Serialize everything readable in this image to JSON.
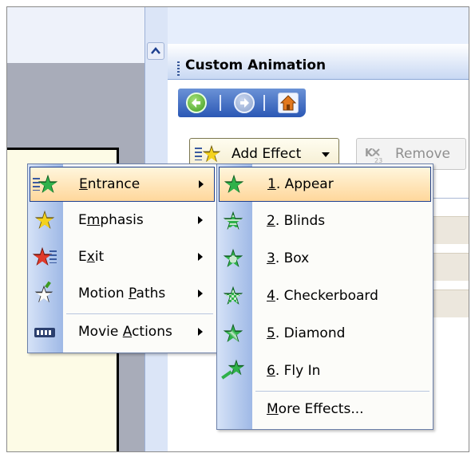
{
  "pane": {
    "title": "Custom Animation"
  },
  "toolbar": {
    "add_effect_label": "Add Effect",
    "remove_label": "Remove"
  },
  "menu1": {
    "items": [
      {
        "pre": "",
        "u": "E",
        "post": "ntrance",
        "icon": "entrance-star-icon",
        "has_submenu": true,
        "highlighted": true
      },
      {
        "pre": "E",
        "u": "m",
        "post": "phasis",
        "icon": "emphasis-star-icon",
        "has_submenu": true
      },
      {
        "pre": "E",
        "u": "x",
        "post": "it",
        "icon": "exit-star-icon",
        "has_submenu": true
      },
      {
        "pre": "Motion ",
        "u": "P",
        "post": "aths",
        "icon": "motion-path-star-icon",
        "has_submenu": true
      },
      {
        "pre": "Movie ",
        "u": "A",
        "post": "ctions",
        "icon": "movie-actions-icon",
        "has_submenu": true
      }
    ]
  },
  "menu2": {
    "items": [
      {
        "pre": "",
        "u": "1",
        "post": ". Appear",
        "icon": "appear-star-icon",
        "highlighted": true
      },
      {
        "pre": "",
        "u": "2",
        "post": ". Blinds",
        "icon": "blinds-star-icon"
      },
      {
        "pre": "",
        "u": "3",
        "post": ". Box",
        "icon": "box-star-icon"
      },
      {
        "pre": "",
        "u": "4",
        "post": ". Checkerboard",
        "icon": "checkerboard-star-icon"
      },
      {
        "pre": "",
        "u": "5",
        "post": ". Diamond",
        "icon": "diamond-star-icon"
      },
      {
        "pre": "",
        "u": "6",
        "post": ". Fly In",
        "icon": "fly-in-star-icon"
      },
      {
        "pre": "",
        "u": "M",
        "post": "ore Effects...",
        "icon": "",
        "separator_before": true
      }
    ]
  },
  "colors": {
    "accent_star_green": "#2e8b3a",
    "star_yellow": "#f4d21e",
    "star_red": "#e03a2a",
    "highlight": "#ffd79b",
    "menu_border": "#1d3f8e"
  }
}
